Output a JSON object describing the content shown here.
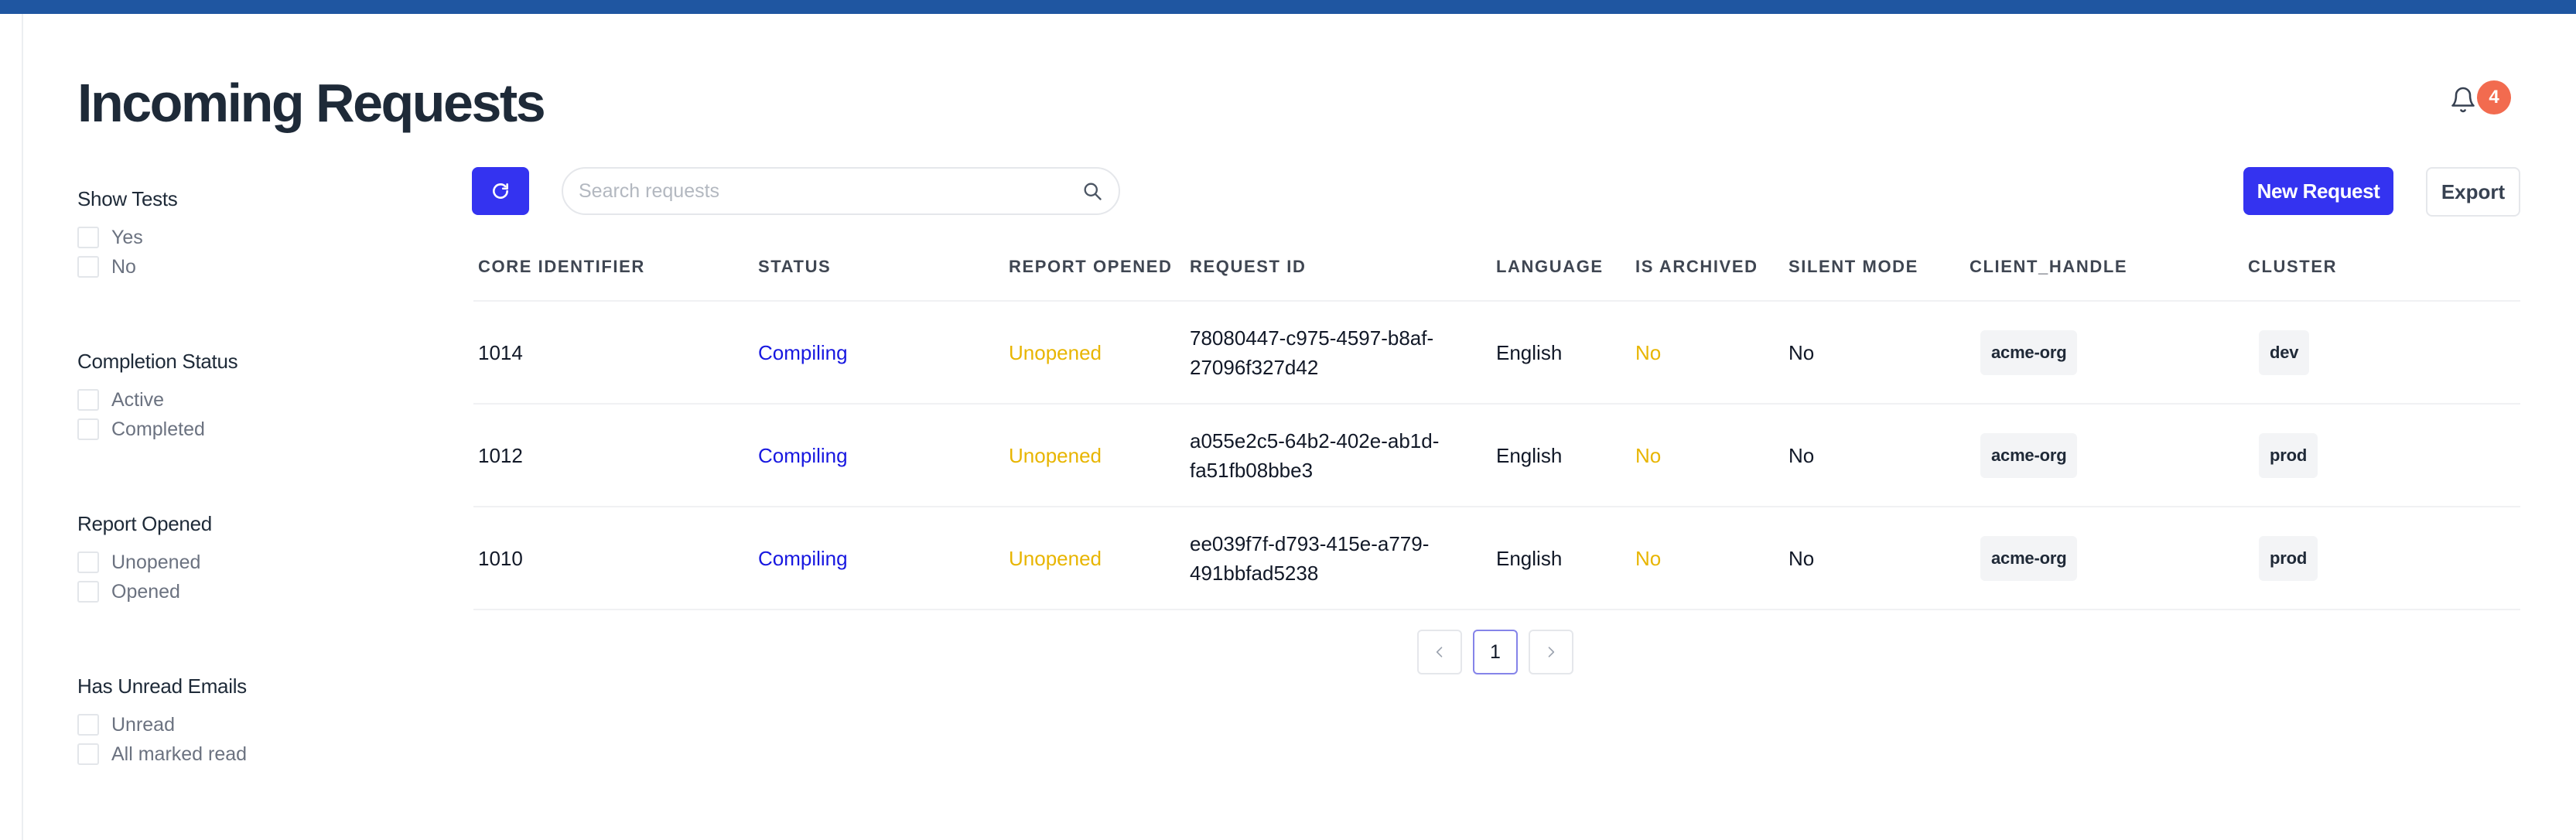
{
  "page": {
    "title": "Incoming Requests"
  },
  "notifications": {
    "count": "4",
    "icon": "bell-icon"
  },
  "filters": [
    {
      "title": "Show Tests",
      "options": [
        "Yes",
        "No"
      ]
    },
    {
      "title": "Completion Status",
      "options": [
        "Active",
        "Completed"
      ]
    },
    {
      "title": "Report Opened",
      "options": [
        "Unopened",
        "Opened"
      ]
    },
    {
      "title": "Has Unread Emails",
      "options": [
        "Unread",
        "All marked read"
      ]
    }
  ],
  "toolbar": {
    "refresh_icon": "refresh-icon",
    "search_placeholder": "Search requests",
    "search_value": "",
    "new_request_label": "New Request",
    "export_label": "Export"
  },
  "table": {
    "headers": [
      "CORE IDENTIFIER",
      "STATUS",
      "REPORT OPENED",
      "REQUEST ID",
      "LANGUAGE",
      "IS ARCHIVED",
      "SILENT MODE",
      "CLIENT_HANDLE",
      "CLUSTER"
    ],
    "rows": [
      {
        "core_identifier": "1014",
        "status": "Compiling",
        "report_opened": "Unopened",
        "request_id": "78080447-c975-4597-b8af-27096f327d42",
        "language": "English",
        "is_archived": "No",
        "silent_mode": "No",
        "client_handle": "acme-org",
        "cluster": "dev"
      },
      {
        "core_identifier": "1012",
        "status": "Compiling",
        "report_opened": "Unopened",
        "request_id": "a055e2c5-64b2-402e-ab1d-fa51fb08bbe3",
        "language": "English",
        "is_archived": "No",
        "silent_mode": "No",
        "client_handle": "acme-org",
        "cluster": "prod"
      },
      {
        "core_identifier": "1010",
        "status": "Compiling",
        "report_opened": "Unopened",
        "request_id": "ee039f7f-d793-415e-a779-491bbfad5238",
        "language": "English",
        "is_archived": "No",
        "silent_mode": "No",
        "client_handle": "acme-org",
        "cluster": "prod"
      }
    ]
  },
  "pagination": {
    "prev": "<",
    "current": "1",
    "next": ">"
  },
  "colors": {
    "topbar": "#1f56a1",
    "primary": "#3433f0",
    "badge": "#f26b4f",
    "status": "#1717e0",
    "warning": "#e8b500"
  }
}
